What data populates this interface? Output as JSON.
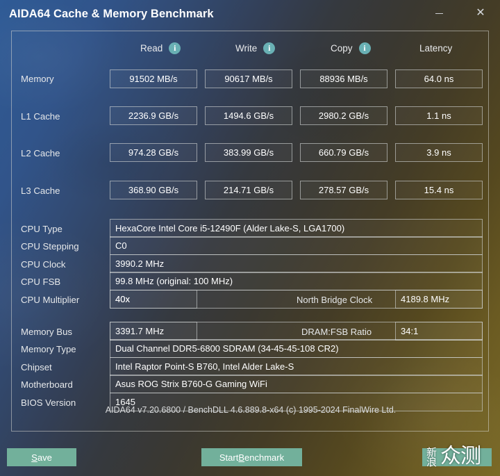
{
  "window": {
    "title": "AIDA64 Cache & Memory Benchmark",
    "minimize_label": "–",
    "close_label": "✕"
  },
  "columns": [
    {
      "label": "Read",
      "info": "i",
      "has_info": true
    },
    {
      "label": "Write",
      "info": "i",
      "has_info": true
    },
    {
      "label": "Copy",
      "info": "i",
      "has_info": true
    },
    {
      "label": "Latency",
      "info": "",
      "has_info": false
    }
  ],
  "benchmark_rows": [
    {
      "label": "Memory",
      "read": "91502 MB/s",
      "write": "90617 MB/s",
      "copy": "88936 MB/s",
      "latency": "64.0 ns"
    },
    {
      "label": "L1 Cache",
      "read": "2236.9 GB/s",
      "write": "1494.6 GB/s",
      "copy": "2980.2 GB/s",
      "latency": "1.1 ns"
    },
    {
      "label": "L2 Cache",
      "read": "974.28 GB/s",
      "write": "383.99 GB/s",
      "copy": "660.79 GB/s",
      "latency": "3.9 ns"
    },
    {
      "label": "L3 Cache",
      "read": "368.90 GB/s",
      "write": "214.71 GB/s",
      "copy": "278.57 GB/s",
      "latency": "15.4 ns"
    }
  ],
  "cpu_info": {
    "type_label": "CPU Type",
    "type_value": "HexaCore Intel Core i5-12490F  (Alder Lake-S, LGA1700)",
    "stepping_label": "CPU Stepping",
    "stepping_value": "C0",
    "clock_label": "CPU Clock",
    "clock_value": "3990.2 MHz",
    "fsb_label": "CPU FSB",
    "fsb_value": "99.8 MHz  (original: 100 MHz)",
    "multiplier_label": "CPU Multiplier",
    "multiplier_value": "40x",
    "nb_clock_label": "North Bridge Clock",
    "nb_clock_value": "4189.8 MHz"
  },
  "memory_info": {
    "bus_label": "Memory Bus",
    "bus_value": "3391.7 MHz",
    "ratio_label": "DRAM:FSB Ratio",
    "ratio_value": "34:1",
    "type_label": "Memory Type",
    "type_value": "Dual Channel DDR5-6800 SDRAM  (34-45-45-108 CR2)",
    "chipset_label": "Chipset",
    "chipset_value": "Intel Raptor Point-S B760, Intel Alder Lake-S",
    "motherboard_label": "Motherboard",
    "motherboard_value": "Asus ROG Strix B760-G Gaming WiFi",
    "bios_label": "BIOS Version",
    "bios_value": "1645"
  },
  "footer": {
    "version_text": "AIDA64 v7.20.6800 / BenchDLL 4.6.889.8-x64  (c) 1995-2024 FinalWire Ltd.",
    "save_button_prefix": "",
    "save_button_accel": "S",
    "save_button_suffix": "ave",
    "start_button_prefix": "Start ",
    "start_button_accel": "B",
    "start_button_suffix": "enchmark",
    "close_button_label": ""
  },
  "watermark": {
    "small": "新浪",
    "big": "众测"
  },
  "colors": {
    "accent_button": "#72b09b",
    "info_icon": "#69b0b4",
    "panel_border": "#d7d7d2",
    "text": "#e9eaec"
  }
}
